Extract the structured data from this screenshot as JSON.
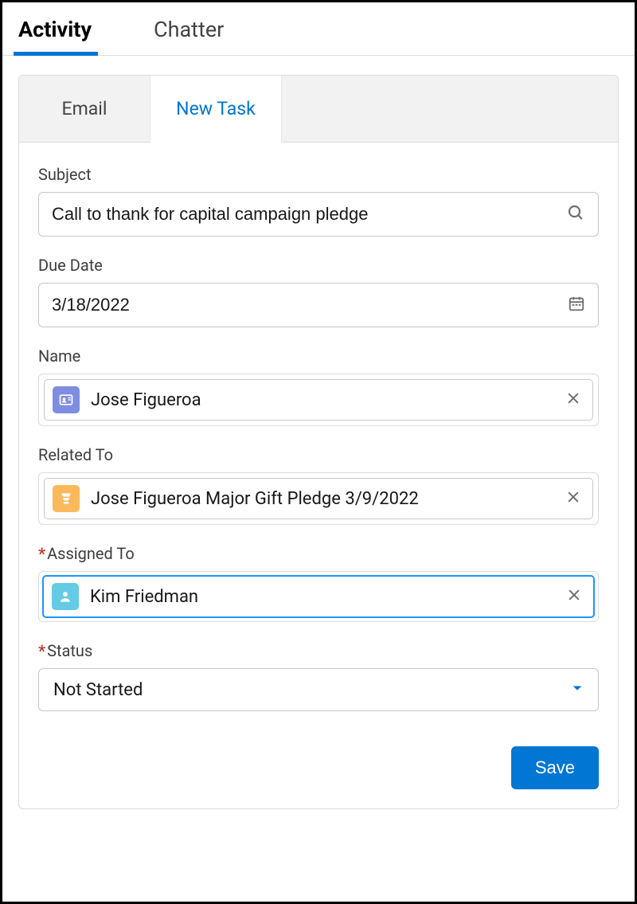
{
  "mainTabs": {
    "activity": "Activity",
    "chatter": "Chatter"
  },
  "subTabs": {
    "email": "Email",
    "newTask": "New Task"
  },
  "labels": {
    "subject": "Subject",
    "dueDate": "Due Date",
    "name": "Name",
    "relatedTo": "Related To",
    "assignedTo": "Assigned To",
    "status": "Status"
  },
  "values": {
    "subject": "Call to thank for capital campaign pledge",
    "dueDate": "3/18/2022",
    "name": "Jose Figueroa",
    "relatedTo": "Jose Figueroa Major Gift Pledge 3/9/2022",
    "assignedTo": "Kim Friedman",
    "status": "Not Started"
  },
  "colors": {
    "contactIcon": "#7f8de1",
    "opportunityIcon": "#fcb95b",
    "userIcon": "#65cae4"
  },
  "buttons": {
    "save": "Save"
  }
}
